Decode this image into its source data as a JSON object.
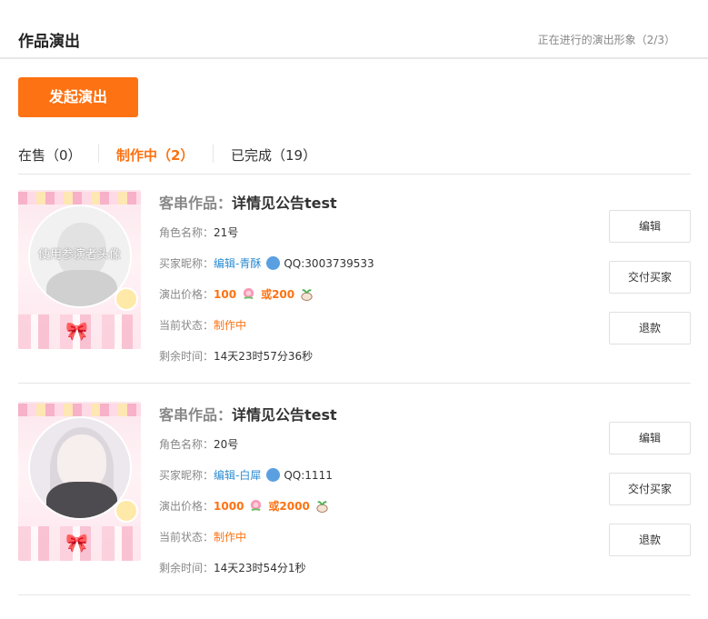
{
  "header": {
    "title": "作品演出",
    "status": "正在进行的演出形象（2/3）"
  },
  "start_button": "发起演出",
  "tabs": [
    {
      "label": "在售（0）"
    },
    {
      "label": "制作中（2）"
    },
    {
      "label": "已完成（19）"
    }
  ],
  "orders": [
    {
      "work_label": "客串作品：",
      "work_title": "详情见公告test",
      "thumb_text": "使用参演者头像",
      "role_key": "角色名称：",
      "role": "21号",
      "buyer_key": "买家昵称：",
      "buyer": "编辑-青酥",
      "qq": "QQ:3003739533",
      "price_key": "演出价格：",
      "price": "100",
      "price_alt": "或200",
      "state_key": "当前状态：",
      "state": "制作中",
      "remain_key": "剩余时间：",
      "remain": "14天23时57分36秒",
      "actions": {
        "edit": "编辑",
        "deliver": "交付买家",
        "refund": "退款"
      }
    },
    {
      "work_label": "客串作品：",
      "work_title": "详情见公告test",
      "role_key": "角色名称：",
      "role": "20号",
      "buyer_key": "买家昵称：",
      "buyer": "编辑-白犀",
      "qq": "QQ:1111",
      "price_key": "演出价格：",
      "price": "1000",
      "price_alt": "或2000",
      "state_key": "当前状态：",
      "state": "制作中",
      "remain_key": "剩余时间：",
      "remain": "14天23时54分1秒",
      "actions": {
        "edit": "编辑",
        "deliver": "交付买家",
        "refund": "退款"
      }
    }
  ],
  "colors": {
    "accent": "#fd7212",
    "link": "#2d8cd2",
    "border": "#e6e6e6"
  }
}
